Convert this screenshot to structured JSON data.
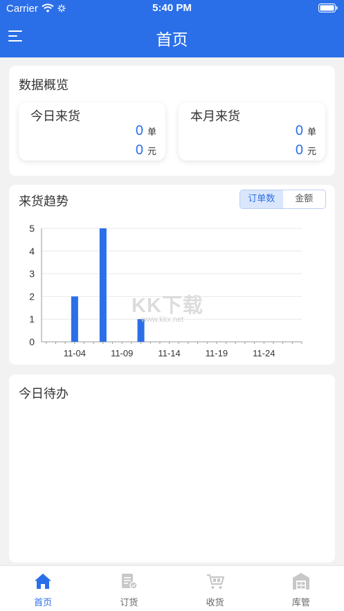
{
  "status_bar": {
    "carrier": "Carrier",
    "time": "5:40 PM"
  },
  "header": {
    "title": "首页",
    "menu_icon": "menu-icon"
  },
  "overview": {
    "title": "数据概览",
    "today": {
      "label": "今日来货",
      "count": "0",
      "count_unit": "单",
      "amount": "0",
      "amount_unit": "元"
    },
    "month": {
      "label": "本月来货",
      "count": "0",
      "count_unit": "单",
      "amount": "0",
      "amount_unit": "元"
    }
  },
  "trend": {
    "title": "来货趋势",
    "toggle": [
      {
        "label": "订单数",
        "active": true
      },
      {
        "label": "金额",
        "active": false
      }
    ]
  },
  "chart_data": {
    "type": "bar",
    "x": [
      "11-01",
      "11-02",
      "11-03",
      "11-04",
      "11-05",
      "11-06",
      "11-07",
      "11-08",
      "11-09",
      "11-10",
      "11-11",
      "11-12",
      "11-13",
      "11-14",
      "11-15",
      "11-16",
      "11-17",
      "11-18",
      "11-19",
      "11-20",
      "11-21",
      "11-22",
      "11-23",
      "11-24",
      "11-25",
      "11-26",
      "11-27",
      "11-28"
    ],
    "values": [
      0,
      0,
      0,
      2,
      0,
      0,
      5,
      0,
      0,
      0,
      1,
      0,
      0,
      0,
      0,
      0,
      0,
      0,
      0,
      0,
      0,
      0,
      0,
      0,
      0,
      0,
      0,
      0
    ],
    "x_tick_labels": [
      "11-04",
      "11-09",
      "11-14",
      "11-19",
      "11-24"
    ],
    "y_ticks": [
      0,
      1,
      2,
      3,
      4,
      5
    ],
    "ylim": [
      0,
      5
    ],
    "grid": true,
    "bar_color": "#2b6fe8"
  },
  "todo": {
    "title": "今日待办"
  },
  "watermark": {
    "text": "KK下载",
    "url": "www.kkx.net"
  },
  "tabbar": {
    "items": [
      {
        "label": "首页",
        "icon": "home-icon",
        "active": true
      },
      {
        "label": "订货",
        "icon": "order-icon",
        "active": false
      },
      {
        "label": "收货",
        "icon": "cart-icon",
        "active": false
      },
      {
        "label": "库管",
        "icon": "warehouse-icon",
        "active": false
      }
    ]
  },
  "colors": {
    "primary": "#2b6fe8",
    "background": "#f2f2f2",
    "inactive_icon": "#c8c8c8"
  }
}
